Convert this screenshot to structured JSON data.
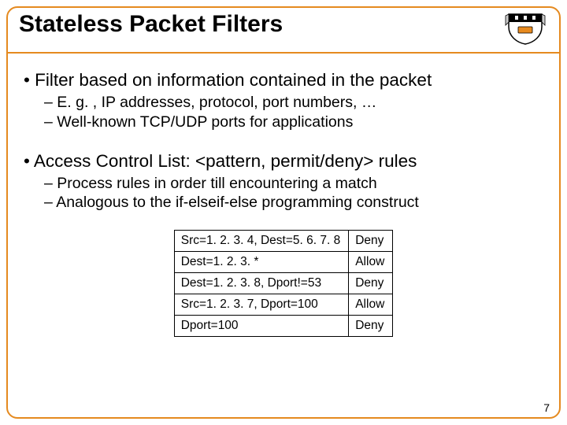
{
  "title": "Stateless Packet Filters",
  "bullets": {
    "b1a": "Filter based on information contained in the packet",
    "b1a_s1": "E. g. , IP addresses, protocol, port numbers, …",
    "b1a_s2": "Well-known TCP/UDP ports for applications",
    "b1b": "Access Control List: <pattern, permit/deny> rules",
    "b1b_s1": "Process rules in order till encountering a match",
    "b1b_s2": "Analogous to the if-elseif-else programming construct"
  },
  "table": {
    "r0": {
      "pattern": "Src=1. 2. 3. 4, Dest=5. 6. 7. 8",
      "action": "Deny"
    },
    "r1": {
      "pattern": "Dest=1. 2. 3. *",
      "action": "Allow"
    },
    "r2": {
      "pattern": "Dest=1. 2. 3. 8, Dport!=53",
      "action": "Deny"
    },
    "r3": {
      "pattern": "Src=1. 2. 3. 7, Dport=100",
      "action": "Allow"
    },
    "r4": {
      "pattern": "Dport=100",
      "action": "Deny"
    }
  },
  "page_number": "7"
}
